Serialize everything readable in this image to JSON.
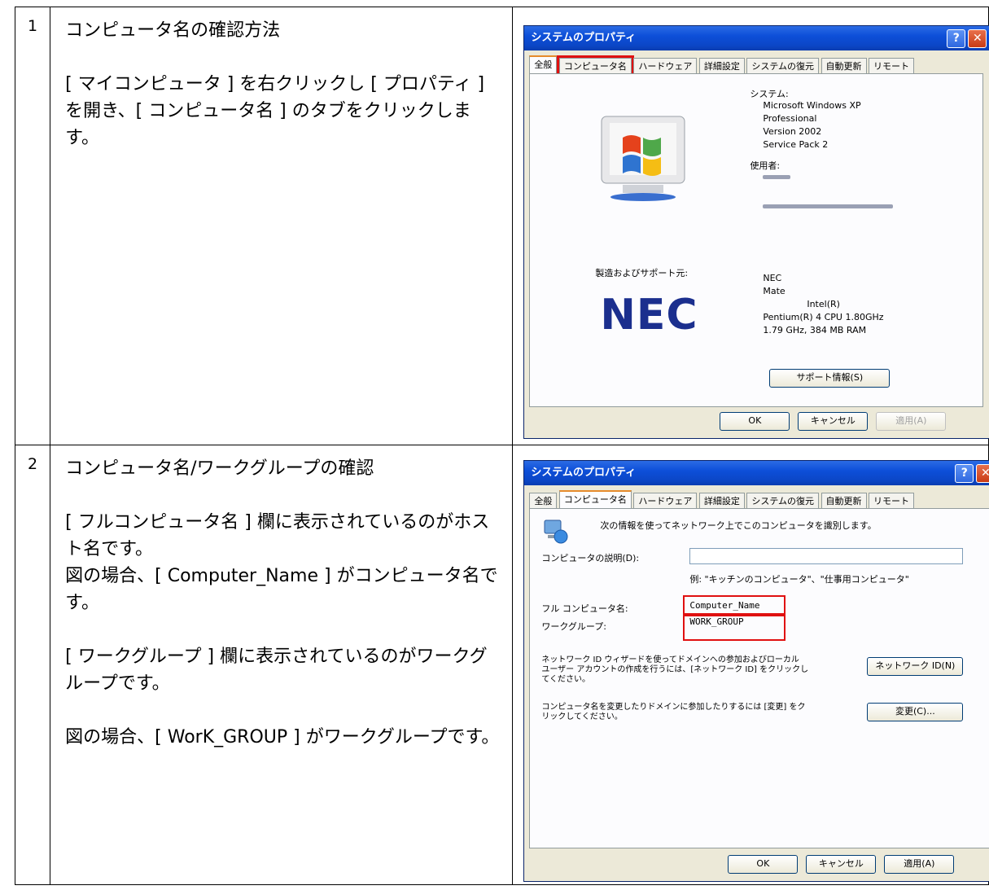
{
  "rows": [
    {
      "num": "1",
      "title": "コンピュータ名の確認方法",
      "paragraphs": [
        "[ マイコンピュータ ] を右クリックし [ プロパティ ] を開き、[ コンピュータ名 ] のタブをクリックします。"
      ]
    },
    {
      "num": "2",
      "title": "コンピュータ名/ワークグループの確認",
      "paragraphs": [
        "[ フルコンピュータ名 ] 欄に表示されているのがホスト名です。",
        "図の場合、[ Computer_Name ] がコンピュータ名です。",
        "[ ワークグループ ] 欄に表示されているのがワークグループです。",
        "図の場合、[ WorK_GROUP ] がワークグループです。"
      ]
    }
  ],
  "dialog": {
    "title": "システムのプロパティ",
    "help_glyph": "?",
    "close_glyph": "✕",
    "tabs": [
      "全般",
      "コンピュータ名",
      "ハードウェア",
      "詳細設定",
      "システムの復元",
      "自動更新",
      "リモート"
    ],
    "ok": "OK",
    "cancel": "キャンセル",
    "apply": "適用(A)"
  },
  "general": {
    "system_label": "システム:",
    "system_lines": [
      "Microsoft Windows XP",
      "Professional",
      "Version 2002",
      "Service Pack 2"
    ],
    "user_label": "使用者:",
    "maker_label": "製造およびサポート元:",
    "maker_lines": [
      "NEC",
      "Mate",
      "Intel(R)",
      "Pentium(R) 4 CPU 1.80GHz",
      "1.79 GHz, 384 MB RAM"
    ],
    "nec_logo": "NEC",
    "support_button": "サポート情報(S)"
  },
  "computer_name": {
    "intro": "次の情報を使ってネットワーク上でこのコンピュータを識別します。",
    "desc_label": "コンピュータの説明(D):",
    "desc_value": "",
    "desc_example": "例: \"キッチンのコンピュータ\"、\"仕事用コンピュータ\"",
    "full_name_label": "フル コンピュータ名:",
    "full_name_value": "Computer_Name",
    "workgroup_label": "ワークグループ:",
    "workgroup_value": "WORK_GROUP",
    "network_id_text": [
      "ネットワーク ID ウィザードを使ってドメインへの参加およびローカル",
      "ユーザー アカウントの作成を行うには、[ネットワーク ID] をクリックし",
      "てください。"
    ],
    "network_id_button": "ネットワーク ID(N)",
    "change_text": [
      "コンピュータ名を変更したりドメインに参加したりするには [変更] をク",
      "リックしてください。"
    ],
    "change_button": "変更(C)..."
  },
  "colors": {
    "highlight": "#e01010",
    "titlebar": "#0b46c6",
    "dialog_bg": "#ece9d8"
  }
}
